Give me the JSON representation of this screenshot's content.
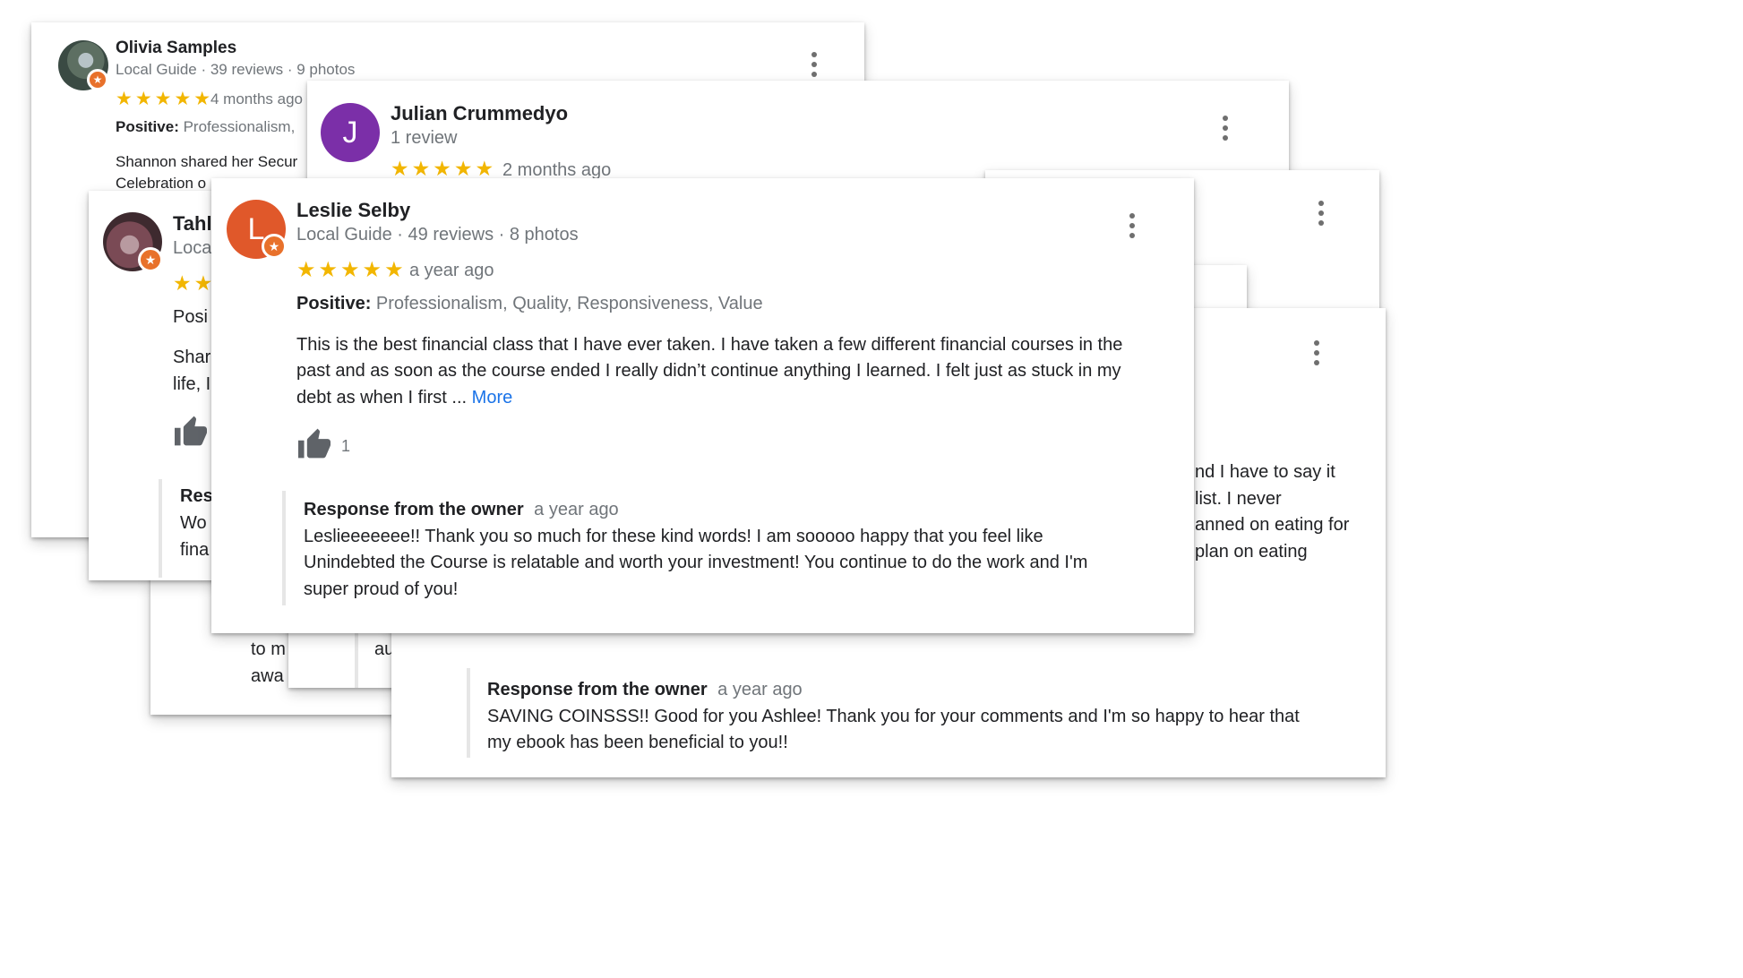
{
  "olivia": {
    "name": "Olivia Samples",
    "meta": "Local Guide · 39 reviews · 9 photos",
    "stars": "★★★★★",
    "time": "4 months ago",
    "positive_label": "Positive:",
    "positive_values": "Professionalism,",
    "text_line1": "Shannon shared her Secur",
    "text_line2": "Celebration o"
  },
  "julian": {
    "initial": "J",
    "name": "Julian Crummedyo",
    "meta": "1 review",
    "stars": "★★★★★",
    "time": "2 months ago"
  },
  "tahl": {
    "name_partial": "Tahl",
    "meta_partial": "Loca",
    "stars_partial": "★★",
    "positive_partial": "Posi",
    "text_line1": "Shar",
    "text_line2": "life, I",
    "response_partial": "Res",
    "resp_line1": "Wo",
    "resp_line2": "fina"
  },
  "hidden_back": {
    "line1": "to m",
    "line2": "awa",
    "line3": "au"
  },
  "ashlee": {
    "text_line1": "nd I have to say it",
    "text_line2": "list. I never",
    "text_line3": "anned on eating for",
    "text_line4": "plan on eating",
    "response_title": "Response from the owner",
    "response_time": "a year ago",
    "response_line1": "SAVING COINSSS!! Good for you Ashlee! Thank you for your comments and I'm so happy to hear that",
    "response_line2": "my ebook has been beneficial to you!!"
  },
  "leslie": {
    "initial": "L",
    "name": "Leslie Selby",
    "meta": "Local Guide · 49 reviews · 8 photos",
    "stars": "★★★★★",
    "time": "a year ago",
    "positive_label": "Positive:",
    "positive_values": "Professionalism, Quality, Responsiveness, Value",
    "text_line1": "This is the best financial class that I have ever taken. I have taken a few different financial courses in the",
    "text_line2": "past and as soon as the course ended I really didn’t continue anything I learned. I felt just as stuck in my",
    "text_line3": "debt as when I first ...",
    "more_label": "More",
    "likes": "1",
    "response_title": "Response from the owner",
    "response_time": "a year ago",
    "response_line1": "Leslieeeeeee!! Thank you so much for these kind words! I am sooooo happy that you feel like",
    "response_line2": "Unindebted the Course is relatable and worth your investment! You continue to do the work and I'm",
    "response_line3": "super proud of you!"
  },
  "colors": {
    "star": "#f2b600",
    "julian_avatar": "#7b2fa8",
    "leslie_avatar": "#e0582a",
    "guide_badge": "#e8712b",
    "more_link": "#1a73e8"
  },
  "icons": [
    "more-vert-icon",
    "thumbs-up-icon",
    "local-guide-badge-icon",
    "star-icon"
  ]
}
